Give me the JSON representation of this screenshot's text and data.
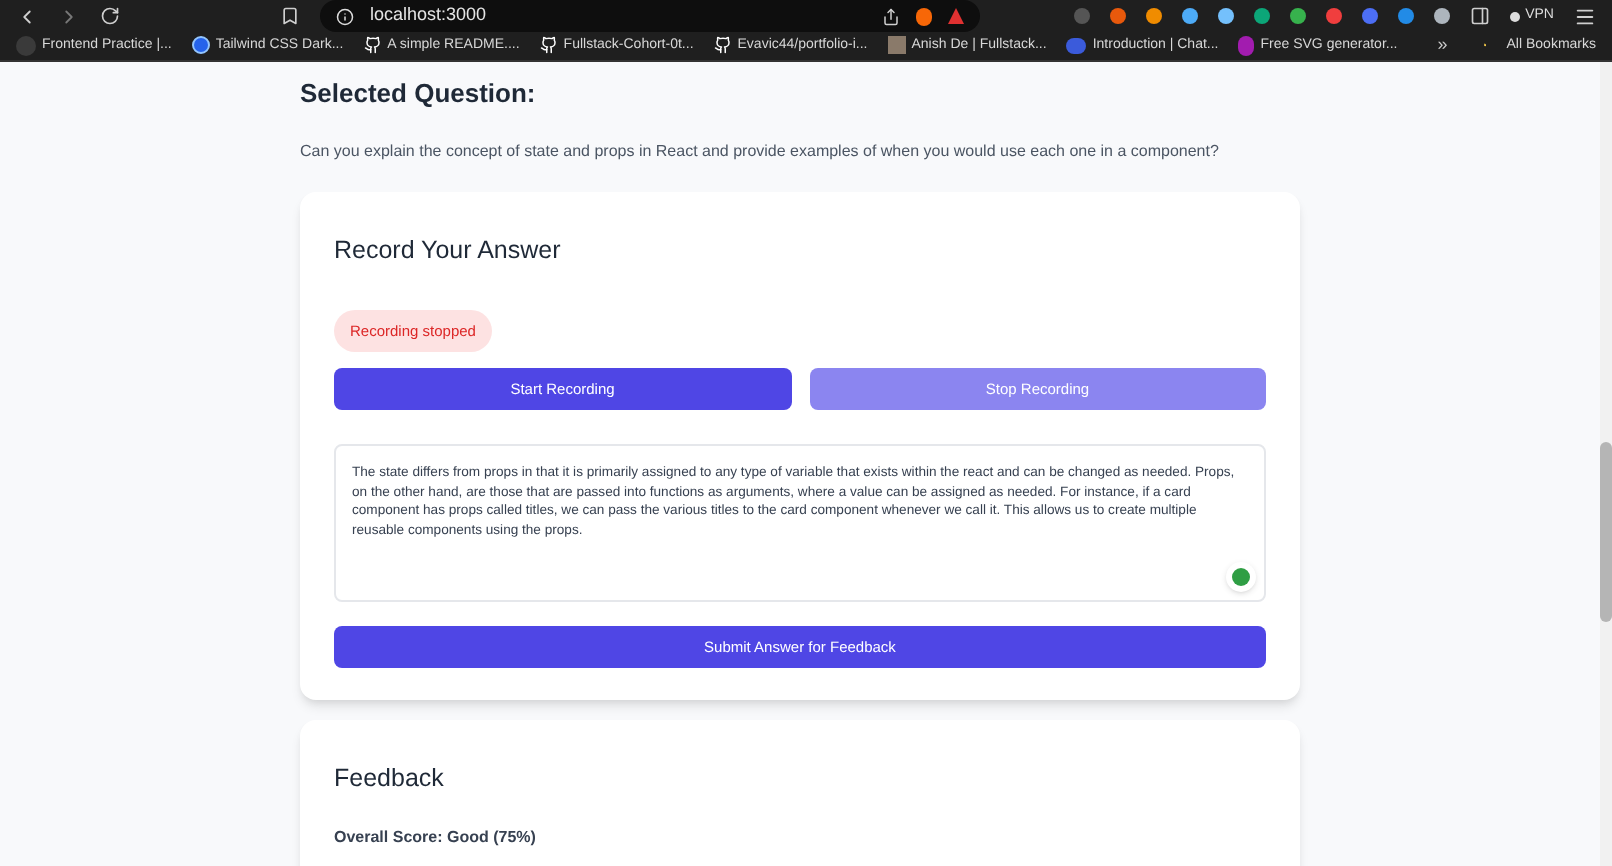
{
  "browser": {
    "url": "localhost:3000",
    "vpn_label": "VPN",
    "bookmarks": [
      {
        "label": "Frontend Practice |...",
        "kind": "fp"
      },
      {
        "label": "Tailwind CSS Dark...",
        "kind": "circle"
      },
      {
        "label": "A simple README....",
        "kind": "github"
      },
      {
        "label": "Fullstack-Cohort-0t...",
        "kind": "github"
      },
      {
        "label": "Evavic44/portfolio-i...",
        "kind": "github"
      },
      {
        "label": "Anish De | Fullstack...",
        "kind": "photo"
      },
      {
        "label": "Introduction | Chat...",
        "kind": "blob"
      },
      {
        "label": "Free SVG generator...",
        "kind": "svg"
      }
    ],
    "overflow": "»",
    "all_bookmarks": "All Bookmarks"
  },
  "question": {
    "heading": "Selected Question:",
    "text": "Can you explain the concept of state and props in React and provide examples of when you would use each one in a component?"
  },
  "record": {
    "title": "Record Your Answer",
    "status": "Recording stopped",
    "buttons": [
      {
        "label": "Start Recording",
        "disabled": false
      },
      {
        "label": "Stop Recording",
        "disabled": true
      }
    ],
    "answer": "The state differs from props in that it is primarily assigned to any type of variable that exists within the react and can be changed as needed. Props, on the other hand, are those that are passed into functions as arguments, where a value can be assigned as needed. For instance, if a card component has props called titles, we can pass the various titles to the card component whenever we call it. This allows us to create multiple reusable components using the props.",
    "submit": "Submit Answer for Feedback"
  },
  "feedback": {
    "title": "Feedback",
    "score": "Overall Score: Good (75%)"
  }
}
